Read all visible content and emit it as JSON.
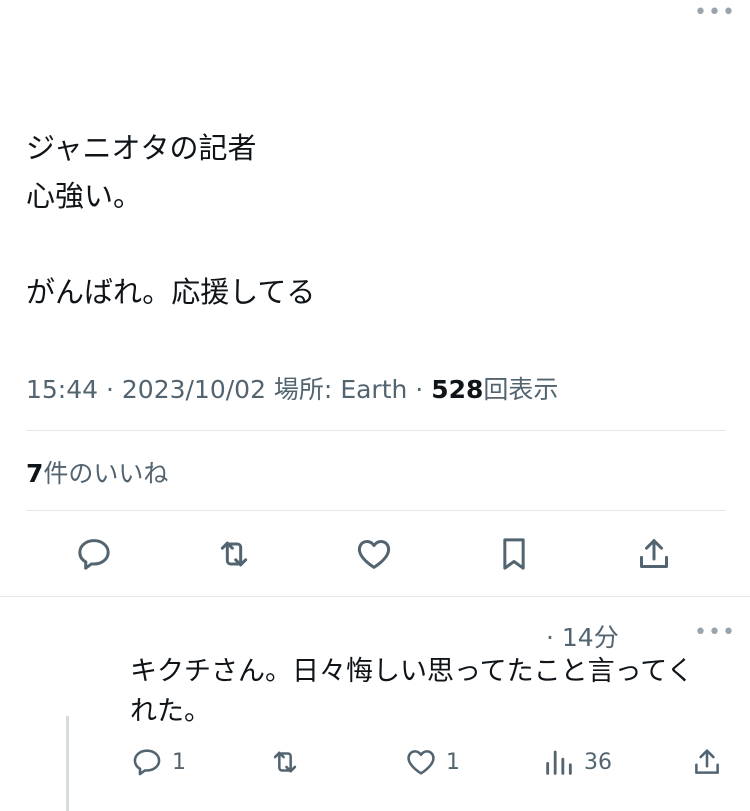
{
  "tweet": {
    "more_icon": "more-horizontal-icon",
    "lines": [
      "ジャニオタの記者",
      "心強い。",
      "",
      "がんばれ。応援してる"
    ],
    "meta": {
      "time": "15:44",
      "sep1": " · ",
      "date": "2023/10/02",
      "location_label": " 場所: ",
      "location": "Earth",
      "sep2": " · ",
      "views": "528",
      "views_label": "回表示"
    },
    "likes": {
      "count": "7",
      "label": "件のいいね"
    },
    "actions": [
      "reply-icon",
      "retweet-icon",
      "like-icon",
      "bookmark-icon",
      "share-icon"
    ]
  },
  "reply": {
    "time": "· 14分",
    "more_icon": "more-horizontal-icon",
    "lines": [
      "キクチさん。日々悔しい思ってたこと言ってく",
      "れた。"
    ],
    "actions": {
      "reply_count": "1",
      "retweet_count": "",
      "like_count": "1",
      "views_count": "36"
    }
  },
  "colors": {
    "text": "#0f1419",
    "secondary": "#536471",
    "divider": "#e3e7ea",
    "icon": "#536471"
  }
}
